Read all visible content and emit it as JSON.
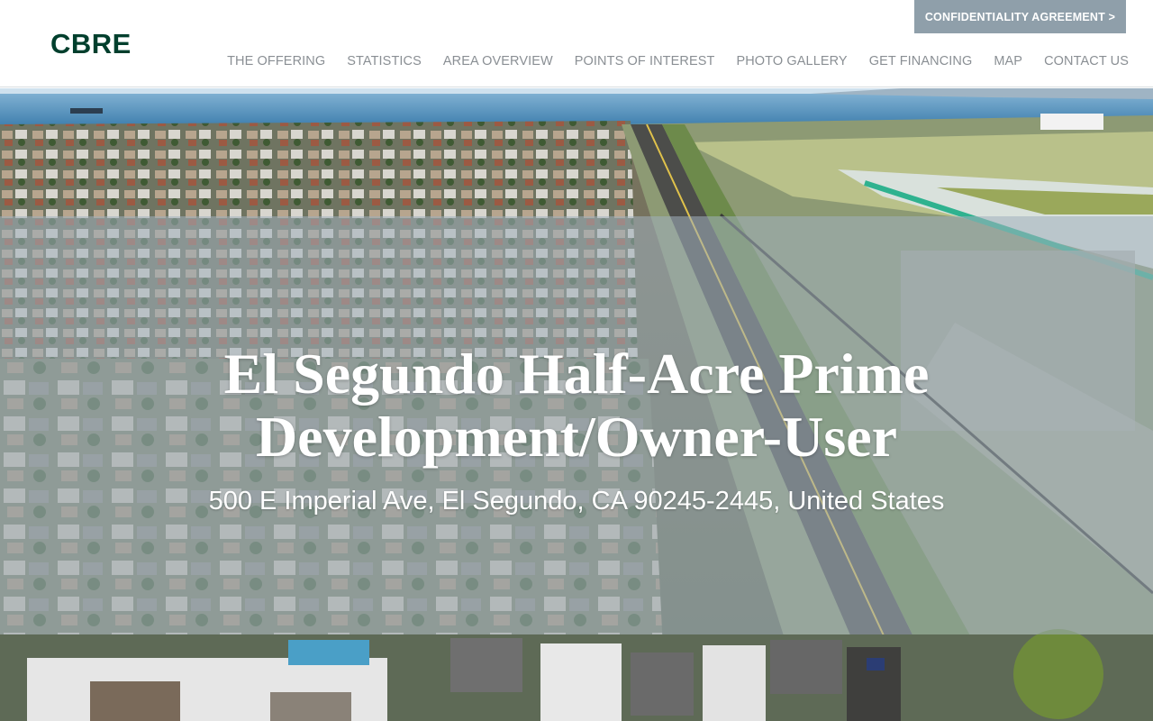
{
  "header": {
    "logo_text": "CBRE",
    "confidentiality_button": "CONFIDENTIALITY AGREEMENT >",
    "nav": [
      {
        "label": "THE OFFERING"
      },
      {
        "label": "STATISTICS"
      },
      {
        "label": "AREA OVERVIEW"
      },
      {
        "label": "POINTS OF INTEREST"
      },
      {
        "label": "PHOTO GALLERY"
      },
      {
        "label": "GET FINANCING"
      },
      {
        "label": "MAP"
      },
      {
        "label": "CONTACT US"
      }
    ]
  },
  "hero": {
    "title_line1": "El Segundo Half-Acre Prime",
    "title_line2": "Development/Owner-User",
    "address": "500 E Imperial Ave, El Segundo, CA 90245-2445, United States"
  },
  "colors": {
    "brand": "#003f2d",
    "confidentiality_bg": "#8f9faa",
    "nav_text": "#8a8f94",
    "overlay": "rgba(160,176,190,0.55)"
  }
}
